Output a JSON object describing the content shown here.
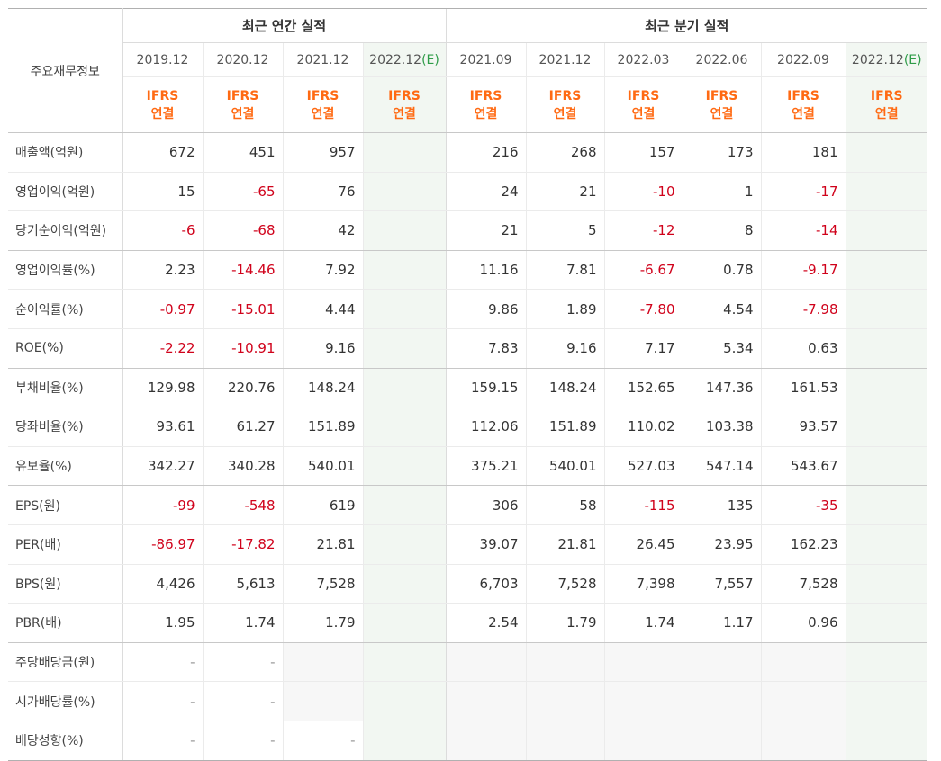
{
  "table": {
    "title": "주요재무정보",
    "annual_header": "최근 연간 실적",
    "quarter_header": "최근 분기 실적",
    "annual_periods": [
      "2019.12",
      "2020.12",
      "2021.12",
      "2022.12"
    ],
    "quarter_periods": [
      "2021.09",
      "2021.12",
      "2022.03",
      "2022.06",
      "2022.09",
      "2022.12"
    ],
    "estimate_mark": "(E)",
    "ifrs_top": "IFRS",
    "ifrs_bottom": "연결",
    "rows": [
      {
        "label": "매출액(억원)",
        "values": [
          "672",
          "451",
          "957",
          "",
          "216",
          "268",
          "157",
          "173",
          "181",
          ""
        ]
      },
      {
        "label": "영업이익(억원)",
        "values": [
          "15",
          "-65",
          "76",
          "",
          "24",
          "21",
          "-10",
          "1",
          "-17",
          ""
        ]
      },
      {
        "label": "당기순이익(억원)",
        "values": [
          "-6",
          "-68",
          "42",
          "",
          "21",
          "5",
          "-12",
          "8",
          "-14",
          ""
        ]
      },
      {
        "label": "영업이익률(%)",
        "values": [
          "2.23",
          "-14.46",
          "7.92",
          "",
          "11.16",
          "7.81",
          "-6.67",
          "0.78",
          "-9.17",
          ""
        ]
      },
      {
        "label": "순이익률(%)",
        "values": [
          "-0.97",
          "-15.01",
          "4.44",
          "",
          "9.86",
          "1.89",
          "-7.80",
          "4.54",
          "-7.98",
          ""
        ]
      },
      {
        "label": "ROE(%)",
        "values": [
          "-2.22",
          "-10.91",
          "9.16",
          "",
          "7.83",
          "9.16",
          "7.17",
          "5.34",
          "0.63",
          ""
        ]
      },
      {
        "label": "부채비율(%)",
        "values": [
          "129.98",
          "220.76",
          "148.24",
          "",
          "159.15",
          "148.24",
          "152.65",
          "147.36",
          "161.53",
          ""
        ]
      },
      {
        "label": "당좌비율(%)",
        "values": [
          "93.61",
          "61.27",
          "151.89",
          "",
          "112.06",
          "151.89",
          "110.02",
          "103.38",
          "93.57",
          ""
        ]
      },
      {
        "label": "유보율(%)",
        "values": [
          "342.27",
          "340.28",
          "540.01",
          "",
          "375.21",
          "540.01",
          "527.03",
          "547.14",
          "543.67",
          ""
        ]
      },
      {
        "label": "EPS(원)",
        "values": [
          "-99",
          "-548",
          "619",
          "",
          "306",
          "58",
          "-115",
          "135",
          "-35",
          ""
        ]
      },
      {
        "label": "PER(배)",
        "values": [
          "-86.97",
          "-17.82",
          "21.81",
          "",
          "39.07",
          "21.81",
          "26.45",
          "23.95",
          "162.23",
          ""
        ]
      },
      {
        "label": "BPS(원)",
        "values": [
          "4,426",
          "5,613",
          "7,528",
          "",
          "6,703",
          "7,528",
          "7,398",
          "7,557",
          "7,528",
          ""
        ]
      },
      {
        "label": "PBR(배)",
        "values": [
          "1.95",
          "1.74",
          "1.79",
          "",
          "2.54",
          "1.79",
          "1.74",
          "1.17",
          "0.96",
          ""
        ]
      },
      {
        "label": "주당배당금(원)",
        "values": [
          "-",
          "-",
          "",
          "",
          "",
          "",
          "",
          "",
          "",
          ""
        ]
      },
      {
        "label": "시가배당률(%)",
        "values": [
          "-",
          "-",
          "",
          "",
          "",
          "",
          "",
          "",
          "",
          ""
        ]
      },
      {
        "label": "배당성향(%)",
        "values": [
          "-",
          "-",
          "-",
          "",
          "",
          "",
          "",
          "",
          "",
          ""
        ]
      }
    ]
  },
  "colors": {
    "negative": "#d0021b",
    "ifrs": "#ff6a13",
    "estimate_bg": "#f2f7f2",
    "estimate_text": "#2e9c48"
  }
}
